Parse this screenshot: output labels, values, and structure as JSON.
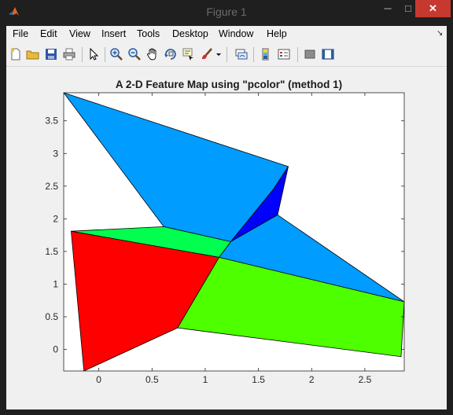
{
  "window": {
    "title": "Figure 1",
    "minimize_glyph": "─",
    "maximize_glyph": "□",
    "close_glyph": "✕"
  },
  "menubar": {
    "items": [
      "File",
      "Edit",
      "View",
      "Insert",
      "Tools",
      "Desktop",
      "Window",
      "Help"
    ]
  },
  "toolbar": {
    "buttons": [
      "new-figure-icon",
      "open-file-icon",
      "save-icon",
      "print-icon",
      "edit-plot-arrow-icon",
      "zoom-in-icon",
      "zoom-out-icon",
      "pan-hand-icon",
      "rotate-3d-icon",
      "data-cursor-icon",
      "brush-icon",
      "brush-dropdown-icon",
      "link-plot-icon",
      "insert-colorbar-icon",
      "insert-legend-icon",
      "hide-plot-tools-icon",
      "show-plot-tools-icon"
    ]
  },
  "chart_data": {
    "type": "heatmap",
    "title": "A 2-D Feature Map using \"pcolor\" (method 1)",
    "xlabel": "",
    "ylabel": "",
    "xlim": [
      -0.33,
      2.87
    ],
    "ylim": [
      -0.33,
      3.93
    ],
    "xticks": [
      0,
      0.5,
      1,
      1.5,
      2,
      2.5
    ],
    "xtick_labels": [
      "0",
      "0.5",
      "1",
      "1.5",
      "2",
      "2.5"
    ],
    "yticks": [
      0,
      0.5,
      1,
      1.5,
      2,
      2.5,
      3,
      3.5
    ],
    "ytick_labels": [
      "0",
      "0.5",
      "1",
      "1.5",
      "2",
      "2.5",
      "3",
      "3.5"
    ],
    "grid": false,
    "cells": [
      {
        "color": "#009cff",
        "vertices": [
          [
            -0.33,
            3.93
          ],
          [
            0.61,
            1.88
          ],
          [
            1.24,
            1.65
          ],
          [
            1.64,
            2.45
          ],
          [
            1.78,
            2.8
          ]
        ]
      },
      {
        "color": "#0000ff",
        "vertices": [
          [
            1.24,
            1.65
          ],
          [
            1.64,
            2.45
          ],
          [
            1.78,
            2.8
          ],
          [
            1.68,
            2.06
          ]
        ]
      },
      {
        "color": "#009cff",
        "vertices": [
          [
            1.24,
            1.65
          ],
          [
            1.68,
            2.06
          ],
          [
            2.87,
            0.73
          ],
          [
            1.13,
            1.41
          ]
        ]
      },
      {
        "color": "#00ff4e",
        "vertices": [
          [
            -0.26,
            1.81
          ],
          [
            0.61,
            1.88
          ],
          [
            1.24,
            1.65
          ],
          [
            1.13,
            1.41
          ]
        ]
      },
      {
        "color": "#ff0000",
        "vertices": [
          [
            -0.26,
            1.81
          ],
          [
            1.13,
            1.41
          ],
          [
            0.74,
            0.33
          ],
          [
            -0.14,
            -0.33
          ]
        ]
      },
      {
        "color": "#4eff00",
        "vertices": [
          [
            1.13,
            1.41
          ],
          [
            2.87,
            0.73
          ],
          [
            2.84,
            -0.11
          ],
          [
            0.74,
            0.33
          ]
        ]
      }
    ]
  }
}
